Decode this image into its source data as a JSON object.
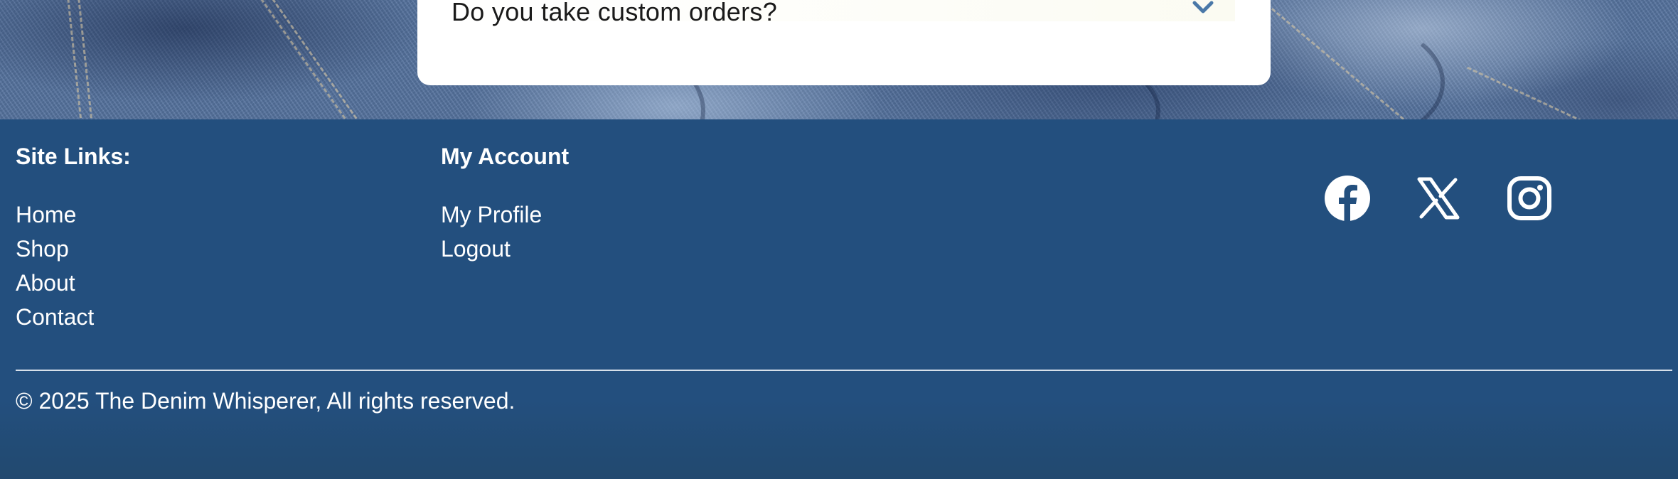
{
  "faq": {
    "question": "Do you take custom orders?",
    "toggle_icon": "chevron-down-icon"
  },
  "footer": {
    "site_links": {
      "heading": "Site Links:",
      "items": [
        "Home",
        "Shop",
        "About",
        "Contact"
      ]
    },
    "my_account": {
      "heading": "My Account",
      "items": [
        "My Profile",
        "Logout"
      ]
    },
    "social": {
      "icons": [
        "facebook-icon",
        "x-icon",
        "instagram-icon"
      ]
    },
    "copyright": "© 2025 The Denim Whisperer, All rights reserved."
  },
  "colors": {
    "footer_bg": "#234f7e",
    "card_bg": "#ffffff",
    "chevron": "#4a78a8",
    "text_light": "#ffffff"
  }
}
